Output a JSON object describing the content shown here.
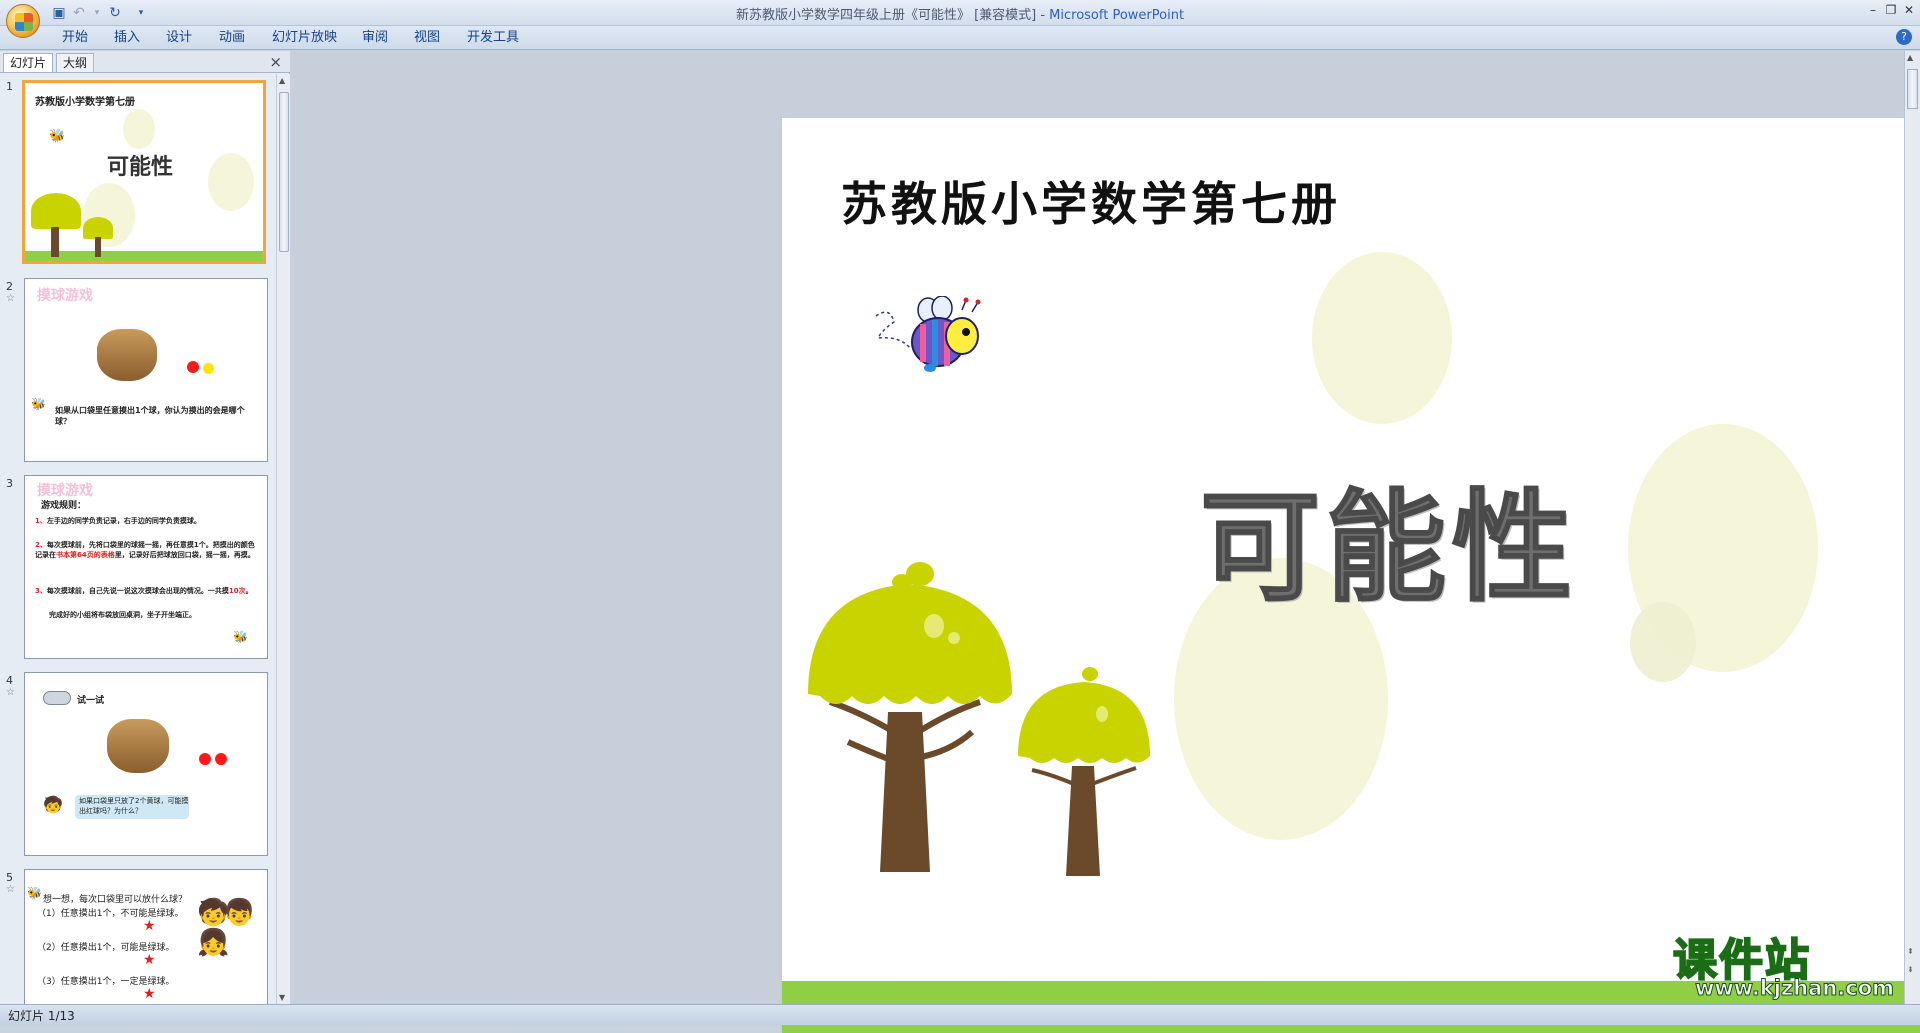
{
  "window": {
    "title_doc": "新苏教版小学数学四年级上册《可能性》 [兼容模式] - ",
    "title_app": "Microsoft PowerPoint"
  },
  "ribbon": {
    "tabs": [
      "开始",
      "插入",
      "设计",
      "动画",
      "幻灯片放映",
      "审阅",
      "视图",
      "开发工具"
    ]
  },
  "pane": {
    "tab_slides": "幻灯片",
    "tab_outline": "大纲",
    "close": "×"
  },
  "thumbnails": [
    {
      "num": "1",
      "title": "苏教版小学数学第七册",
      "main": "可能性"
    },
    {
      "num": "2",
      "title": "摸球游戏",
      "text": "如果从口袋里任意摸出1个球，你认为摸出的会是哪个球？"
    },
    {
      "num": "3",
      "title": "摸球游戏",
      "rule_head": "游戏规则：",
      "rules": [
        {
          "n": "1、",
          "t": "左手边的同学负责记录，右手边的同学负责摸球。"
        },
        {
          "n": "2、",
          "t": "每次摸球前，先将口袋里的球摇一摇，再任意摸1个。把摸出的颜色记录在",
          "hl": "书本第64页的表格",
          "t2": "里，记录好后把球放回口袋，摇一摇，再摸。"
        },
        {
          "n": "3、",
          "t": "每次摸球前，自己先说一说这次摸球会出现的情况。一共摸",
          "hl": "10次",
          "t2": "。"
        }
      ],
      "footer": "完成好的小组将布袋放回桌洞，坐子开坐端正。"
    },
    {
      "num": "4",
      "title": "试一试",
      "bubble": "如果口袋里只放了2个黄球，可能摸出红球吗？为什么？"
    },
    {
      "num": "5",
      "q": "想一想，每次口袋里可以放什么球？",
      "items": [
        "（1）任意摸出1个，不可能是绿球。",
        "（2）任意摸出1个，可能是绿球。",
        "（3）任意摸出1个，一定是绿球。"
      ]
    }
  ],
  "slide": {
    "title": "苏教版小学数学第七册",
    "main_title": "可能性"
  },
  "status": {
    "slide_indicator": "幻灯片 1/13"
  },
  "watermark": {
    "cn": "课件站",
    "url": "www.kjzhan.com"
  },
  "colors": {
    "grass": "#8fce45",
    "tree_canopy": "#c9d300",
    "tree_trunk": "#6b4a2c",
    "bubble": "#f4f4d6",
    "selection": "#f3a43a"
  }
}
